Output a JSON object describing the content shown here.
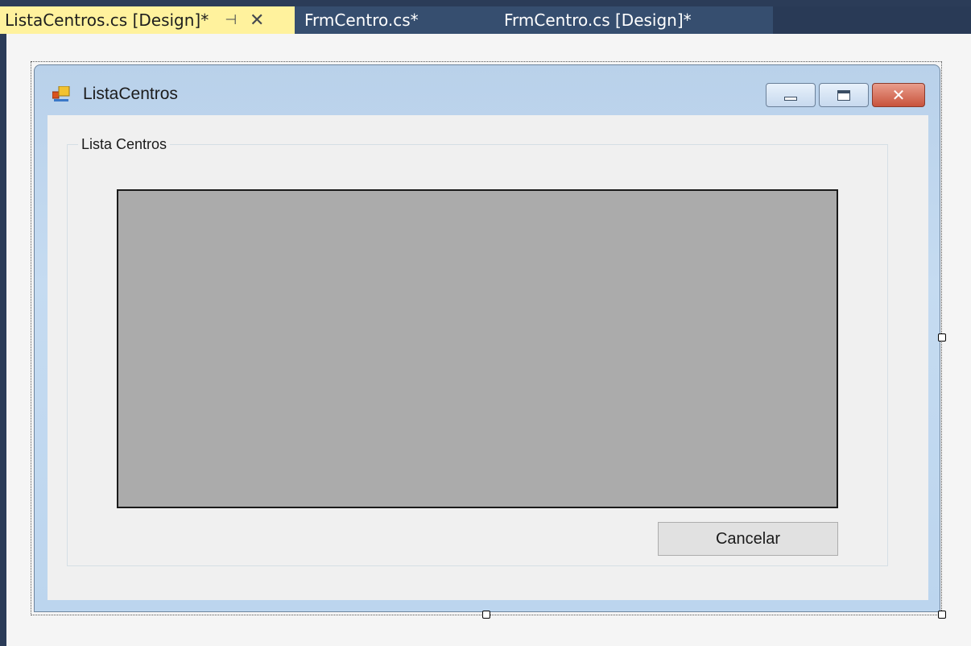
{
  "tabs": [
    {
      "label": "ListaCentros.cs [Design]*",
      "active": true
    },
    {
      "label": "FrmCentro.cs*",
      "active": false
    },
    {
      "label": "FrmCentro.cs [Design]*",
      "active": false
    }
  ],
  "tab_icons": {
    "pin": "pin-icon",
    "close": "close-icon"
  },
  "form": {
    "title": "ListaCentros",
    "groupbox_label": "Lista Centros",
    "cancel_label": "Cancelar"
  },
  "colors": {
    "active_tab": "#fff29d",
    "inactive_tab": "#364e6f",
    "tab_strip": "#2b3c58",
    "datagrid_background": "#ababab",
    "close_button": "#c8533c"
  }
}
